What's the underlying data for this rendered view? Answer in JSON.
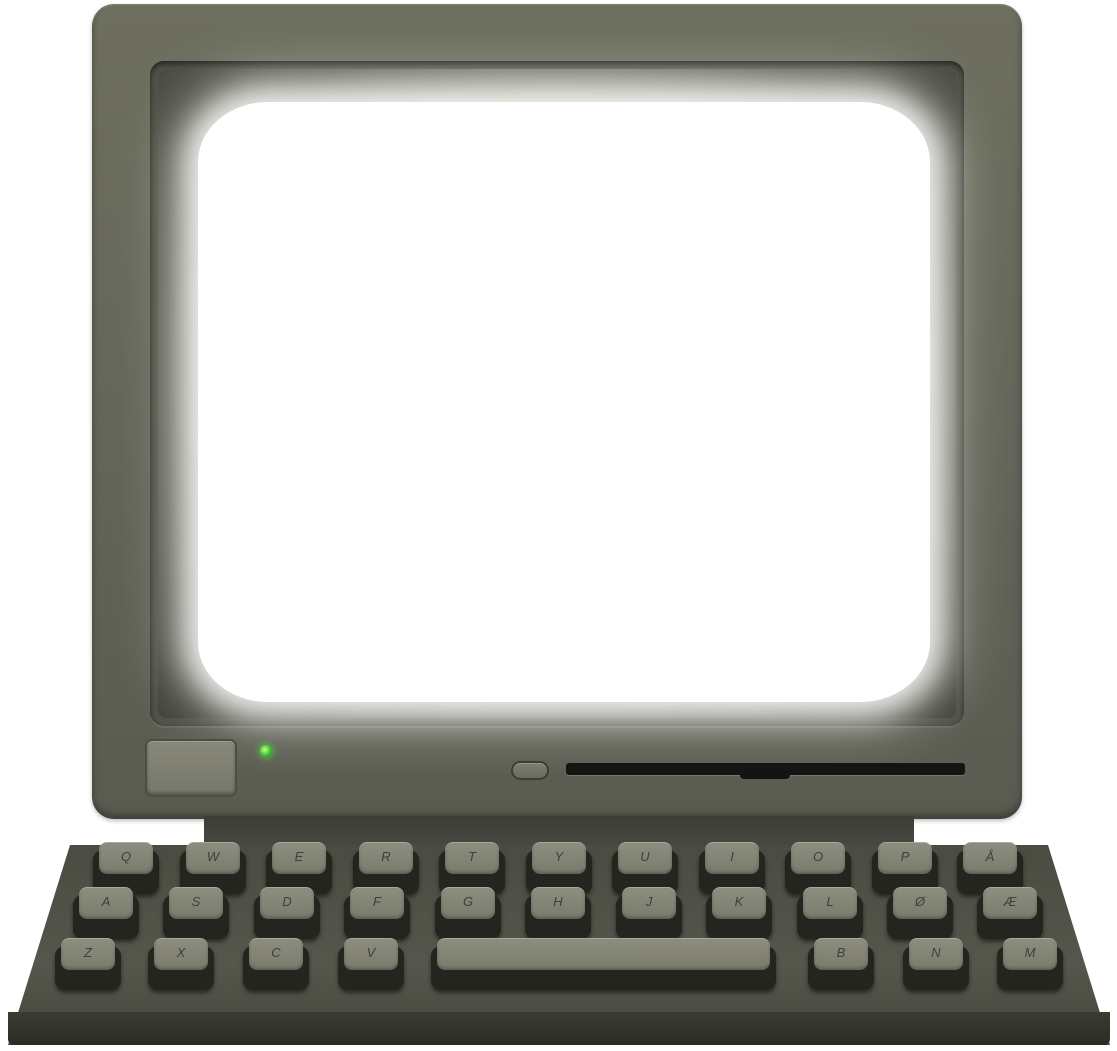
{
  "keyboard": {
    "row1": [
      "Q",
      "W",
      "E",
      "R",
      "T",
      "Y",
      "U",
      "I",
      "O",
      "P",
      "Å"
    ],
    "row2": [
      "A",
      "S",
      "D",
      "F",
      "G",
      "H",
      "J",
      "K",
      "L",
      "Ø",
      "Æ"
    ],
    "row3_left": [
      "Z",
      "X",
      "C",
      "V"
    ],
    "row3_right": [
      "B",
      "N",
      "M"
    ]
  },
  "colors": {
    "body": "#66675b",
    "screen": "#ffffff",
    "led": "#48c93a",
    "keycap": "#85867a"
  }
}
